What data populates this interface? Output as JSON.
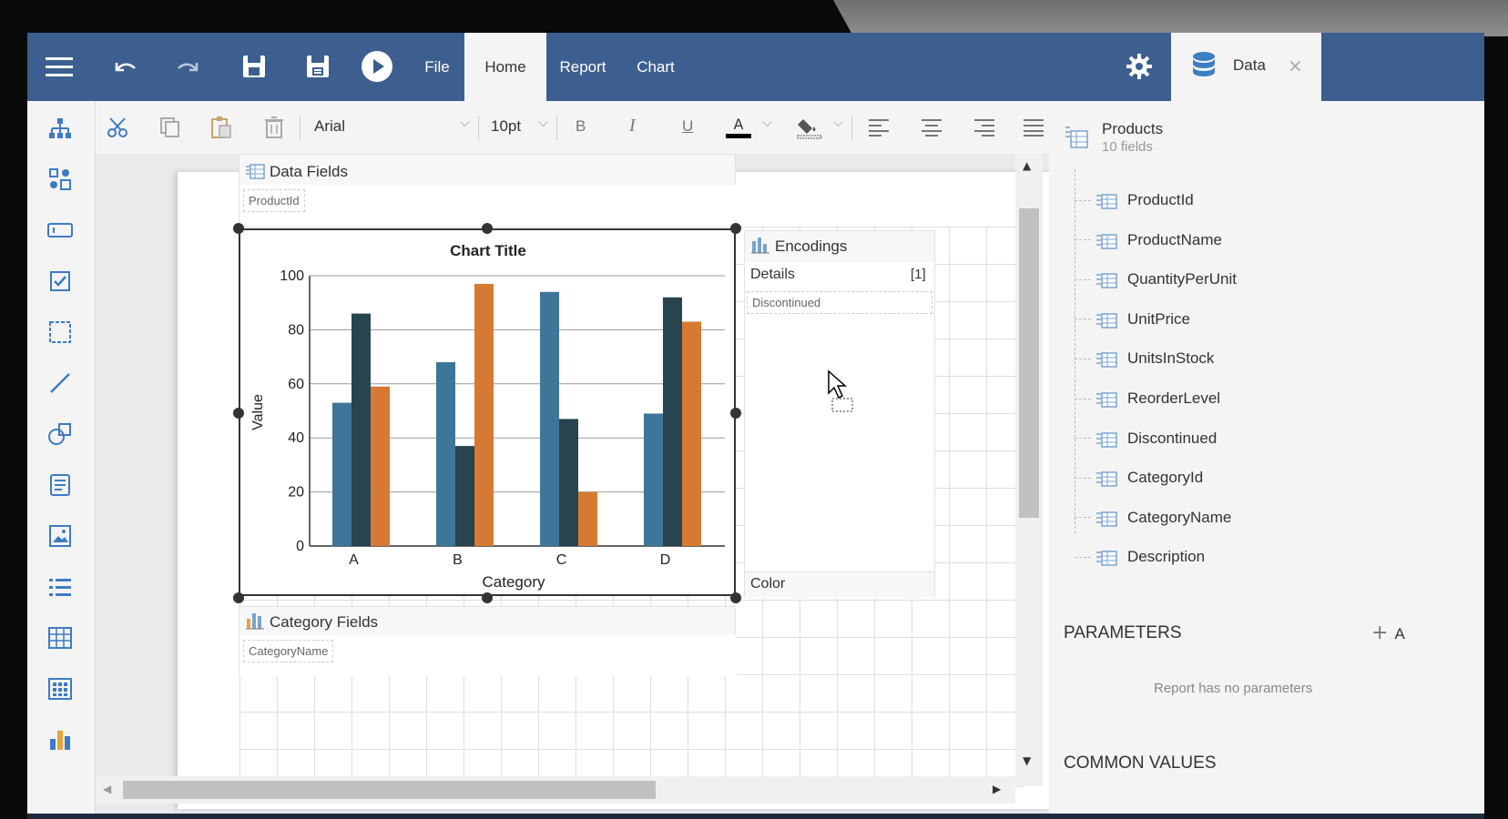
{
  "topbar": {
    "tabs": [
      "File",
      "Home",
      "Report",
      "Chart"
    ],
    "active_tab": "Home",
    "data_tab_label": "Data"
  },
  "ribbon": {
    "font_family": "Arial",
    "font_size": "10pt",
    "bold": "B",
    "italic": "I",
    "underline": "U",
    "font_color_glyph": "A"
  },
  "data_fields": {
    "header": "Data Fields",
    "chip": "ProductId"
  },
  "category_fields": {
    "header": "Category Fields",
    "chip": "CategoryName"
  },
  "encodings": {
    "header": "Encodings",
    "details_label": "Details",
    "details_count": "[1]",
    "details_chip": "Discontinued",
    "color_label": "Color"
  },
  "chart_data": {
    "type": "bar",
    "title": "Chart Title",
    "xlabel": "Category",
    "ylabel": "Value",
    "categories": [
      "A",
      "B",
      "C",
      "D"
    ],
    "ylim": [
      0,
      100
    ],
    "yticks": [
      0,
      20,
      40,
      60,
      80,
      100
    ],
    "series": [
      {
        "values": [
          53,
          68,
          94,
          49
        ],
        "color": "#3d7699"
      },
      {
        "values": [
          86,
          37,
          47,
          92
        ],
        "color": "#27444f"
      },
      {
        "values": [
          59,
          97,
          20,
          83
        ],
        "color": "#d67a33"
      }
    ],
    "grid": true
  },
  "data_panel": {
    "dataset_name": "Products",
    "dataset_count": "10 fields",
    "fields": [
      "ProductId",
      "ProductName",
      "QuantityPerUnit",
      "UnitPrice",
      "UnitsInStock",
      "ReorderLevel",
      "Discontinued",
      "CategoryId",
      "CategoryName",
      "Description"
    ],
    "parameters_header": "PARAMETERS",
    "add_label": "A",
    "no_params": "Report has no parameters",
    "common_values_header": "COMMON VALUES"
  },
  "colors": {
    "topbar": "#3c5f8f",
    "accent": "#3d7699"
  }
}
